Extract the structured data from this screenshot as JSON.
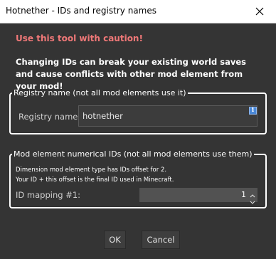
{
  "window": {
    "title": "Hotnether - IDs and registry names"
  },
  "caution_text": "Use this tool with caution!",
  "warning_text": "Changing IDs can break your existing world saves and cause conflicts with other mod element from your mod!",
  "registry_group": {
    "legend": "Registry name (not all mod elements use it)",
    "field_label": "Registry name:",
    "field_value": "hotnether",
    "info_glyph": "i"
  },
  "ids_group": {
    "legend": "Mod element numerical IDs (not all mod elements use them)",
    "description_line1": "Dimension mod element type has IDs offset for 2.",
    "description_line2": "Your ID + this offset is the final ID used in Minecraft.",
    "mapping_label": "ID mapping #1:",
    "mapping_value": "1"
  },
  "buttons": {
    "ok_label": "OK",
    "cancel_label": "Cancel"
  },
  "colors": {
    "caution": "#f07878",
    "background": "#343434",
    "titlebar": "#ffffff"
  }
}
